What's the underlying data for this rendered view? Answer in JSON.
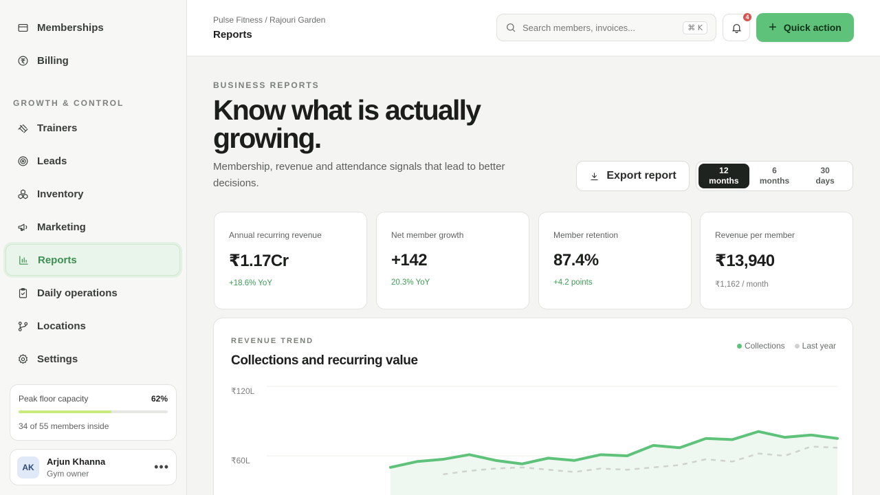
{
  "sidebar": {
    "top_items": [
      {
        "label": "Memberships",
        "icon": "card-icon"
      },
      {
        "label": "Billing",
        "icon": "rupee-icon"
      }
    ],
    "section_label": "GROWTH & CONTROL",
    "items": [
      {
        "label": "Trainers",
        "icon": "dumbbell-icon"
      },
      {
        "label": "Leads",
        "icon": "target-icon"
      },
      {
        "label": "Inventory",
        "icon": "boxes-icon"
      },
      {
        "label": "Marketing",
        "icon": "megaphone-icon"
      },
      {
        "label": "Reports",
        "icon": "bar-chart-icon",
        "active": true
      },
      {
        "label": "Daily operations",
        "icon": "clipboard-check-icon"
      },
      {
        "label": "Locations",
        "icon": "branch-icon"
      },
      {
        "label": "Settings",
        "icon": "gear-icon"
      }
    ],
    "capacity": {
      "label": "Peak floor capacity",
      "percent": "62%",
      "fill": 0.62,
      "sub": "34 of 55 members inside"
    },
    "user": {
      "initials": "AK",
      "name": "Arjun Khanna",
      "role": "Gym owner"
    }
  },
  "header": {
    "breadcrumb": "Pulse Fitness / Rajouri Garden",
    "title": "Reports",
    "search_placeholder": "Search members, invoices...",
    "shortcut": "⌘ K",
    "notification_count": "4",
    "quick_action": "Quick action"
  },
  "hero": {
    "eyebrow": "BUSINESS REPORTS",
    "title": "Know what is actually growing.",
    "subtitle": "Membership, revenue and attendance signals that lead to better decisions.",
    "export_label": "Export report",
    "ranges": [
      {
        "line1": "12",
        "line2": "months",
        "active": true
      },
      {
        "line1": "6",
        "line2": "months"
      },
      {
        "line1": "30",
        "line2": "days"
      }
    ]
  },
  "stats": [
    {
      "label": "Annual recurring revenue",
      "value": "₹1.17Cr",
      "delta": "+18.6% YoY",
      "muted": false
    },
    {
      "label": "Net member growth",
      "value": "+142",
      "delta": "20.3% YoY",
      "muted": false
    },
    {
      "label": "Member retention",
      "value": "87.4%",
      "delta": "+4.2 points",
      "muted": false
    },
    {
      "label": "Revenue per member",
      "value": "₹13,940",
      "delta": "₹1,162 / month",
      "muted": true
    }
  ],
  "colors": {
    "accent": "#5ec27a",
    "accent_dark": "#3d8f52",
    "last_year": "#cfd2cf"
  },
  "chart": {
    "eyebrow": "REVENUE TREND",
    "title": "Collections and recurring value"
  },
  "chart_data": {
    "type": "line",
    "title": "Collections and recurring value",
    "ylabel": "",
    "ylim": [
      0,
      120
    ],
    "y_ticks": [
      "₹120L",
      "₹60L"
    ],
    "y_tick_values": [
      120,
      60
    ],
    "legend_placement": "top-right",
    "grid": true,
    "series": [
      {
        "name": "Collections",
        "color": "#5ec27a",
        "values": [
          50,
          55,
          57,
          61,
          56,
          53,
          58,
          56,
          61,
          60,
          69,
          67,
          75,
          74,
          81,
          76,
          78,
          75
        ]
      },
      {
        "name": "Last year",
        "color": "#cfd2cf",
        "values": [
          44,
          47,
          49,
          50,
          48,
          46,
          49,
          48,
          50,
          52,
          57,
          55,
          62,
          60,
          68,
          67
        ]
      }
    ]
  }
}
